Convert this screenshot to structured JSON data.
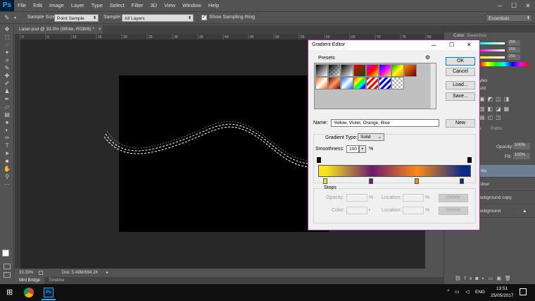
{
  "app": {
    "logo": "Ps",
    "menu": [
      "File",
      "Edit",
      "Image",
      "Layer",
      "Type",
      "Select",
      "Filter",
      "3D",
      "View",
      "Window",
      "Help"
    ],
    "window_controls": [
      "─",
      "☐",
      "✕"
    ]
  },
  "options": {
    "sample_size_label": "Sample Size:",
    "sample_size_value": "Point Sample",
    "sample_label": "Sample:",
    "sample_value": "All Layers",
    "show_ring_label": "Show Sampling Ring",
    "workspace": "Essentials"
  },
  "document": {
    "tab_title": "Laser.psd @ 33.3% (White, RGB/8) *",
    "zoom": "33.33%",
    "doc_size": "Doc: 5.49M/694.2K",
    "ruler_labels": [
      "0",
      "5",
      "10",
      "15",
      "20",
      "25",
      "30",
      "35",
      "40",
      "45",
      "50",
      "55",
      "60",
      "65",
      "70",
      "75",
      "80"
    ]
  },
  "bottom_tabs": [
    "Mini Bridge",
    "Timeline"
  ],
  "right_panel": {
    "color_tab": "Color",
    "swatches_tab": "Swatches",
    "values": [
      "255",
      "255",
      "255"
    ],
    "styles_tab": "yles",
    "adjustments": "ent",
    "layers_tabs": [
      "ls",
      "Paths"
    ],
    "opacity_label": "Opacity:",
    "opacity_value": "100%",
    "fill_label": "Fill:",
    "fill_value": "100%",
    "layers": [
      "hite",
      "olour",
      "ackground copy",
      "ackground"
    ]
  },
  "dialog": {
    "title": "Gradient Editor",
    "presets_label": "Presets",
    "ok": "OK",
    "cancel": "Cancel",
    "load": "Load...",
    "save": "Save...",
    "name_label": "Name:",
    "name_value": "Yellow, Violet, Orange, Blue",
    "new": "New",
    "gradient_type_label": "Gradient Type:",
    "gradient_type_value": "Solid",
    "smoothness_label": "Smoothness:",
    "smoothness_value": "100",
    "smoothness_unit": "%",
    "stops_label": "Stops",
    "opacity_label": "Opacity:",
    "opacity_unit": "%",
    "location_label": "Location:",
    "location_unit": "%",
    "color_label": "Color:",
    "delete": "Delete",
    "colors": {
      "yellow": "#f6e61a",
      "violet": "#6b1b6e",
      "orange": "#ff8a17",
      "blue": "#0a2a8a"
    }
  },
  "taskbar": {
    "time": "13:51",
    "date": "25/05/2017",
    "lang": "ENG"
  }
}
